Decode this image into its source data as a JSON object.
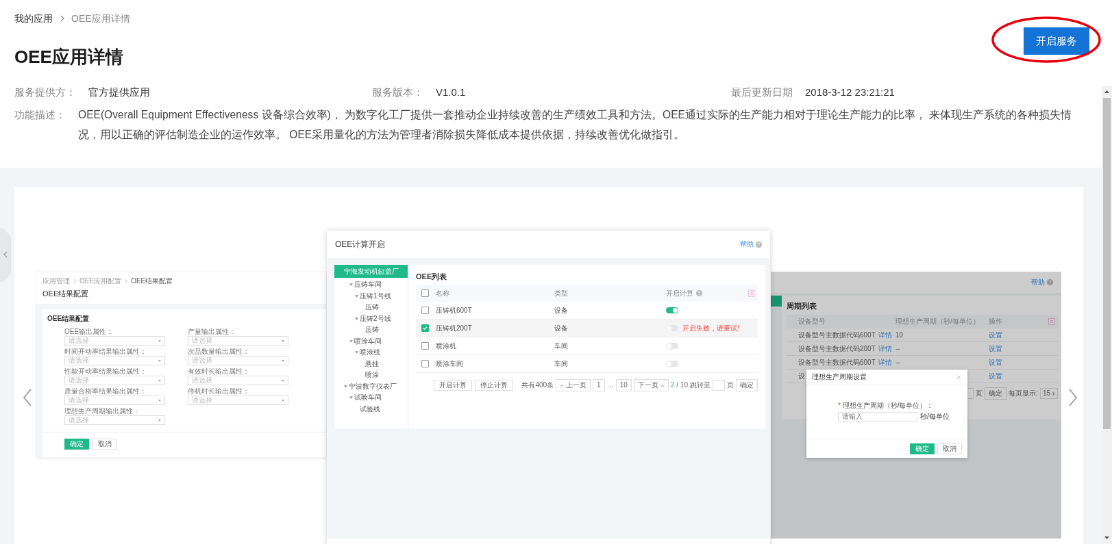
{
  "breadcrumb": [
    {
      "label": "我的应用",
      "current": false
    },
    {
      "label": "OEE应用详情",
      "current": true
    }
  ],
  "title": "OEE应用详情",
  "primary_button": "开启服务",
  "info": [
    {
      "label": "服务提供方：",
      "value": "官方提供应用"
    },
    {
      "label": "服务版本：",
      "value": "V1.0.1"
    },
    {
      "label": "最后更新日期",
      "value": "2018-3-12 23:21:21"
    }
  ],
  "description": {
    "label": "功能描述：",
    "text": "OEE(Overall Equipment Effectiveness 设备综合效率)， 为数字化工厂提供一套推动企业持续改善的生产绩效工具和方法。OEE通过实际的生产能力相对于理论生产能力的比率， 来体现生产系统的各种损失情况，用以正确的评估制造企业的运作效率。 OEE采用量化的方法为管理者消除损失降低成本提供依据，持续改善优化做指引。"
  },
  "config_slide": {
    "breadcrumb": [
      {
        "label": "应用管理",
        "current": false
      },
      {
        "label": "OEE应用配置",
        "current": false
      },
      {
        "label": "OEE结果配置",
        "current": true
      }
    ],
    "title": "OEE结果配置",
    "section_title": "OEE结果配置",
    "fields": [
      {
        "label": "OEE输出属性：",
        "placeholder": "请选择"
      },
      {
        "label": "产量输出属性：",
        "placeholder": "请选择"
      },
      {
        "label": "时间开动率结果输出属性：",
        "placeholder": "请选择"
      },
      {
        "label": "次品数量输出属性：",
        "placeholder": "请选择"
      },
      {
        "label": "性能开动率结果输出属性：",
        "placeholder": "请选择"
      },
      {
        "label": "有效时长输出属性：",
        "placeholder": "请选择"
      },
      {
        "label": "质量合格率结果输出属性：",
        "placeholder": "请选择"
      },
      {
        "label": "停机时长输出属性：",
        "placeholder": "请选择"
      },
      {
        "label": "理想生产周期输出属性：",
        "placeholder": "请选择"
      }
    ],
    "buttons": [
      {
        "label": "确定",
        "kind": "primary"
      },
      {
        "label": "取消",
        "kind": "default"
      }
    ]
  },
  "calc_slide": {
    "title": "OEE计算开启",
    "help": "帮助",
    "tree": [
      {
        "label": "宁海发动机缸盖厂",
        "selected": true,
        "children": [
          {
            "label": "压铸车间",
            "selected": false,
            "children": [
              {
                "label": "压铸1号线",
                "selected": false,
                "children": [
                  {
                    "label": "压铸",
                    "selected": false
                  }
                ]
              },
              {
                "label": "压铸2号线",
                "selected": false,
                "children": [
                  {
                    "label": "压铸",
                    "selected": false
                  }
                ]
              }
            ]
          },
          {
            "label": "喷涂车间",
            "selected": false,
            "children": [
              {
                "label": "喷涂线",
                "selected": false,
                "children": [
                  {
                    "label": "悬挂",
                    "selected": false
                  },
                  {
                    "label": "喷涂",
                    "selected": false
                  }
                ]
              }
            ]
          }
        ]
      },
      {
        "label": "宁波数字仪表厂",
        "selected": false,
        "children": [
          {
            "label": "试验车间",
            "selected": false,
            "children": [
              {
                "label": "试验线",
                "selected": false
              }
            ]
          }
        ]
      }
    ],
    "list_title": "OEE列表",
    "all_checked": false,
    "columns": [
      "名称",
      "类型",
      "开启计算"
    ],
    "rows": [
      {
        "name": "压铸机600T",
        "type": "设备",
        "on": true,
        "selected": false
      },
      {
        "name": "压铸机200T",
        "type": "设备",
        "on": false,
        "selected": true,
        "error": "开启失败，请重试!"
      },
      {
        "name": "喷涂机",
        "type": "车间",
        "on": false,
        "selected": false
      },
      {
        "name": "喷涂车间",
        "type": "车间",
        "on": false,
        "selected": false
      }
    ],
    "actions": [
      "开启计算",
      "停止计算"
    ],
    "pagination": {
      "total": "共有400条",
      "prev": "上一页",
      "pages": [
        "1",
        "…",
        "10"
      ],
      "next": "下一页",
      "current": "2",
      "of": "/ 10",
      "jump": "跳转至",
      "unit": "页",
      "confirm": "确定"
    }
  },
  "cycle_slide": {
    "help": "帮助",
    "list_title": "周期列表",
    "columns": [
      "设备型号",
      "理想生产周期（秒/每单位）",
      "操作"
    ],
    "rows": [
      {
        "model": "设备型号主数据代码600T",
        "link": "详情",
        "cycle": "10",
        "action": "设置"
      },
      {
        "model": "设备型号主数据代码200T",
        "link": "详情",
        "cycle": "--",
        "action": "设置"
      },
      {
        "model": "设备型号主数据代码600T",
        "link": "详情",
        "cycle": "--",
        "action": "设置"
      },
      {
        "model": "设",
        "action": "设置"
      }
    ],
    "pagination": {
      "unit": "页",
      "confirm": "确定",
      "page_size_label": "每页显示:",
      "page_size": "15"
    },
    "modal": {
      "title": "理想生产周期设置",
      "required_mark": "*",
      "label": "理想生产周期（秒/每单位）：",
      "placeholder": "请输入",
      "unit": "秒/每单位",
      "buttons": [
        {
          "label": "确定",
          "kind": "primary"
        },
        {
          "label": "取消",
          "kind": "default"
        }
      ]
    }
  }
}
